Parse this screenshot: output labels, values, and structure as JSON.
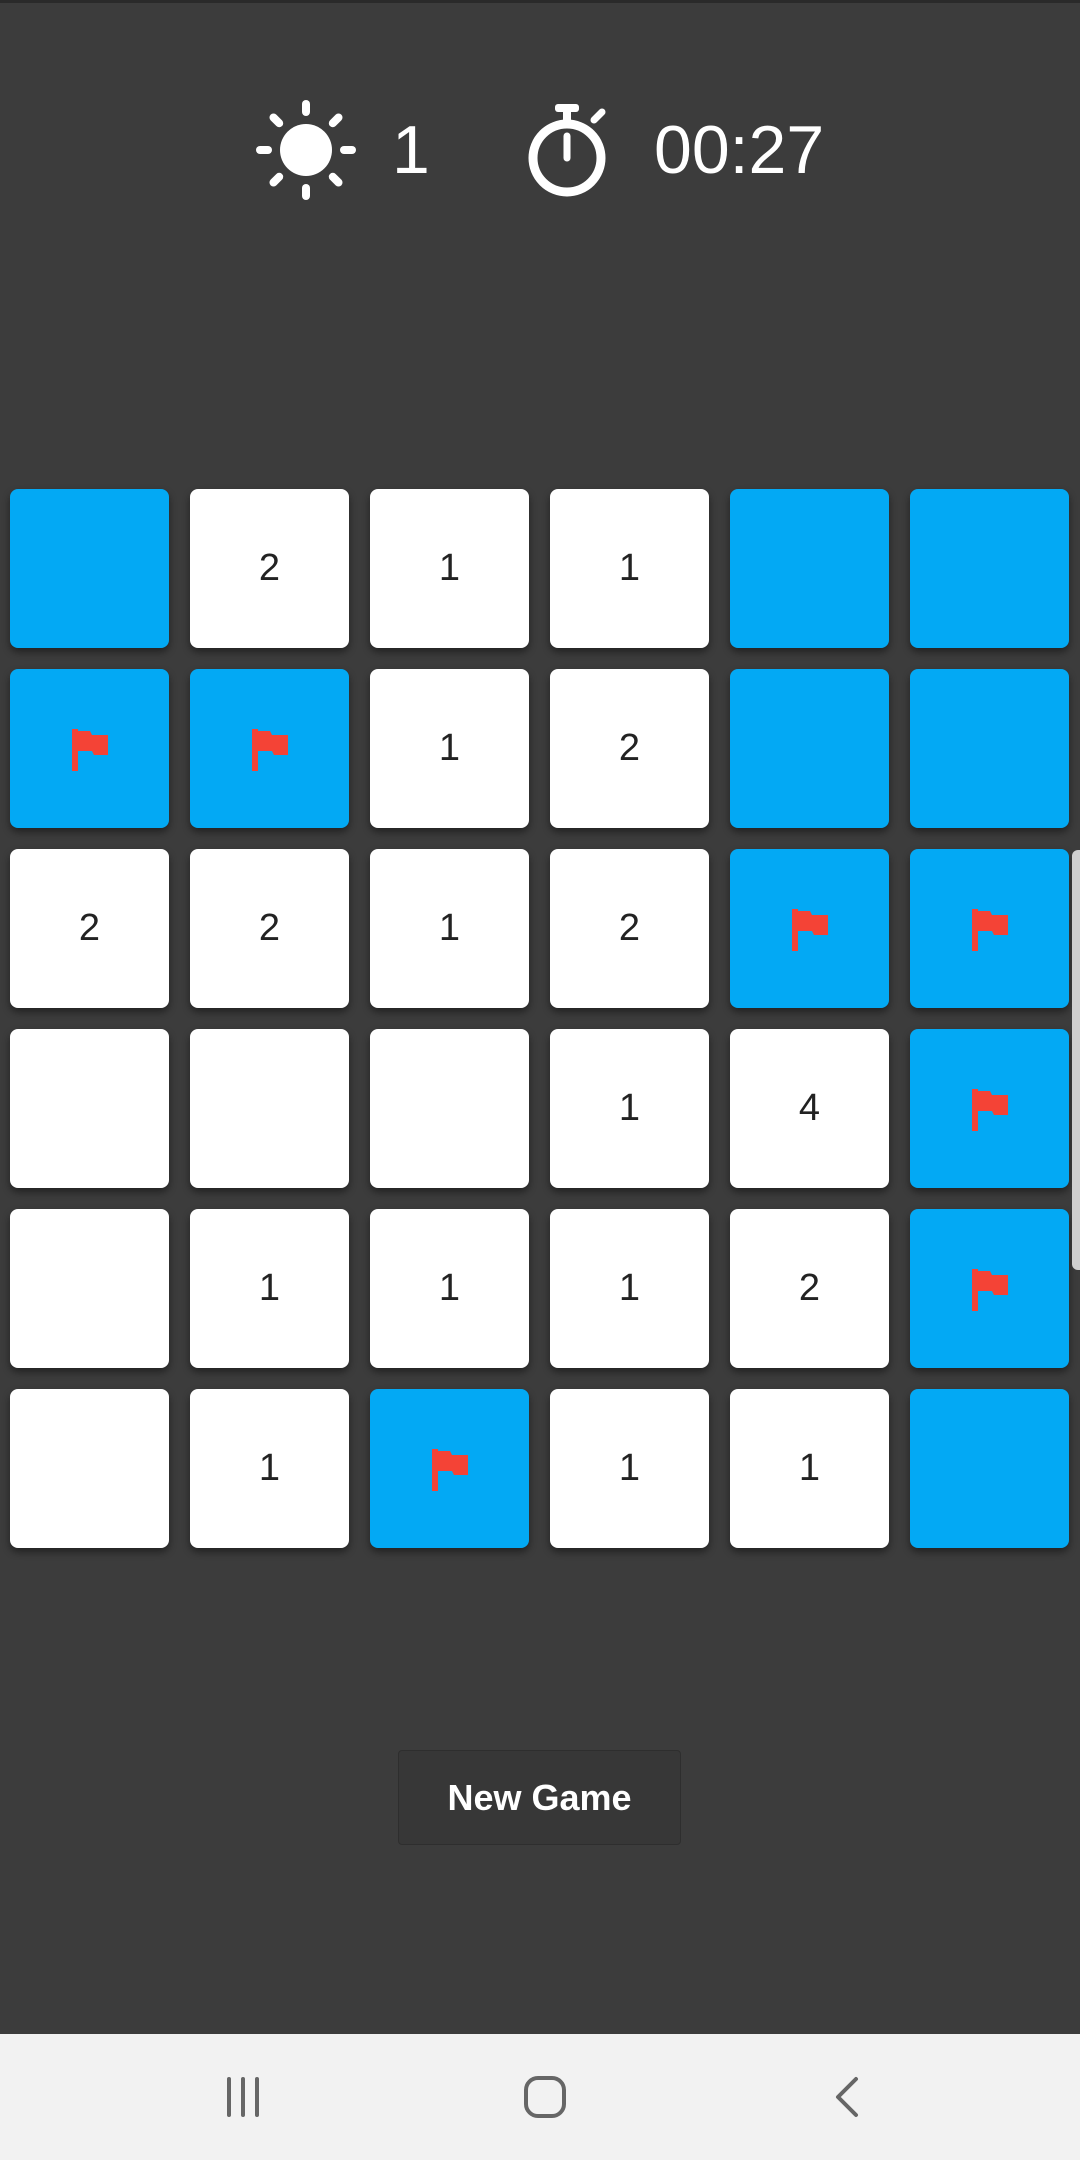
{
  "header": {
    "mines_left": "1",
    "timer": "00:27"
  },
  "board": {
    "rows": 6,
    "cols": 6,
    "cells": [
      [
        "hidden",
        "2",
        "1",
        "1",
        "hidden",
        "hidden"
      ],
      [
        "flag",
        "flag",
        "1",
        "2",
        "hidden",
        "hidden"
      ],
      [
        "2",
        "2",
        "1",
        "2",
        "flag",
        "flag"
      ],
      [
        "",
        "",
        "",
        "1",
        "4",
        "flag"
      ],
      [
        "",
        "1",
        "1",
        "1",
        "2",
        "flag"
      ],
      [
        "",
        "1",
        "flag",
        "1",
        "1",
        "hidden"
      ]
    ]
  },
  "actions": {
    "new_game_label": "New Game"
  },
  "icons": {
    "mine": "sun-mine-icon",
    "timer": "stopwatch-icon",
    "flag": "flag-icon",
    "recents": "recents-icon",
    "home": "home-icon",
    "back": "back-icon"
  },
  "colors": {
    "background": "#3c3c3c",
    "hidden_tile": "#03a9f4",
    "revealed_tile": "#ffffff",
    "flag": "#f44336",
    "navbar": "#f2f2f2"
  }
}
